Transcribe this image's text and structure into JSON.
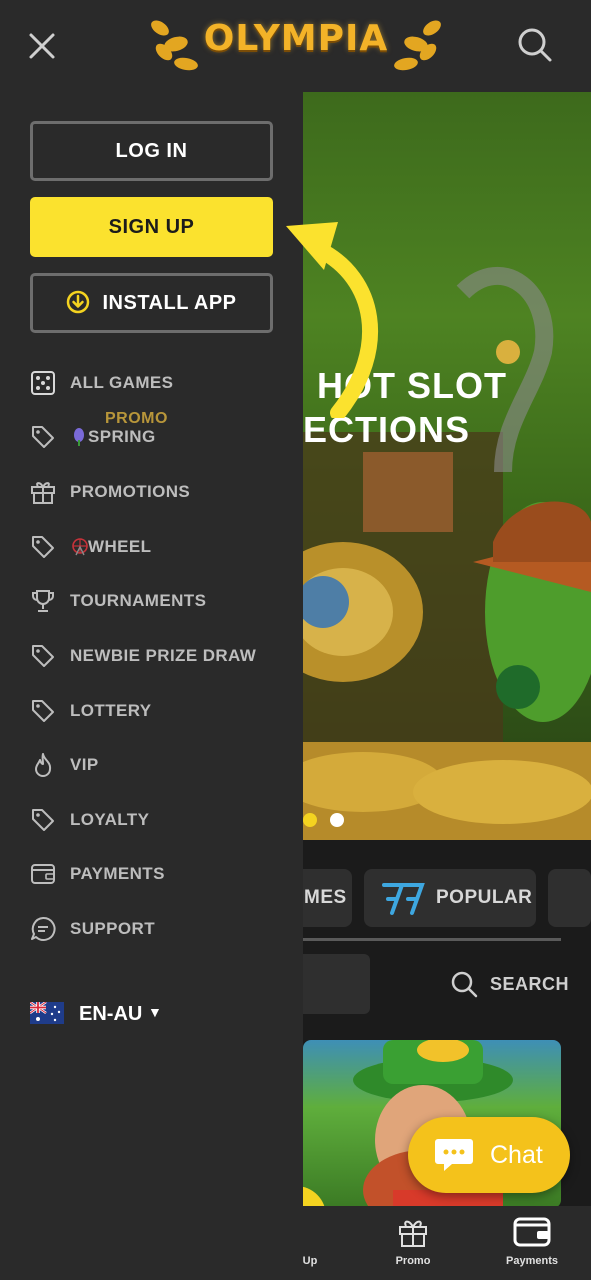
{
  "header": {
    "logo_text": "OLYMPIA",
    "close_icon": "close-icon",
    "search_icon": "search-icon"
  },
  "drawer": {
    "login_label": "LOG IN",
    "signup_label": "SIGN UP",
    "install_label": "INSTALL APP",
    "promo_tag": "PROMO",
    "menu": [
      {
        "label": "ALL GAMES",
        "icon": "dice-icon"
      },
      {
        "label": "SPRING",
        "icon": "tag-icon"
      },
      {
        "label": "PROMOTIONS",
        "icon": "gift-icon"
      },
      {
        "label": "WHEEL",
        "icon": "tag-icon"
      },
      {
        "label": "TOURNAMENTS",
        "icon": "trophy-icon"
      },
      {
        "label": "NEWBIE PRIZE DRAW",
        "icon": "tag-icon"
      },
      {
        "label": "LOTTERY",
        "icon": "tag-icon"
      },
      {
        "label": "VIP",
        "icon": "flame-icon"
      },
      {
        "label": "LOYALTY",
        "icon": "tag-icon"
      },
      {
        "label": "PAYMENTS",
        "icon": "wallet-icon"
      },
      {
        "label": "SUPPORT",
        "icon": "chat-bubble-icon"
      }
    ],
    "language": "EN-AU"
  },
  "main": {
    "hero_line1": "HOT SLOT",
    "hero_line2": "ECTIONS",
    "chip_games": "MES",
    "chip_popular": "POPULAR",
    "search_label": "SEARCH"
  },
  "chat": {
    "label": "Chat"
  },
  "bottom_nav": {
    "signup_label": "Up",
    "promo_label": "Promo",
    "payments_label": "Payments"
  },
  "colors": {
    "accent": "#fbe22e",
    "drawer_bg": "#2a2a2a",
    "chat_bg": "#f4c21b"
  }
}
